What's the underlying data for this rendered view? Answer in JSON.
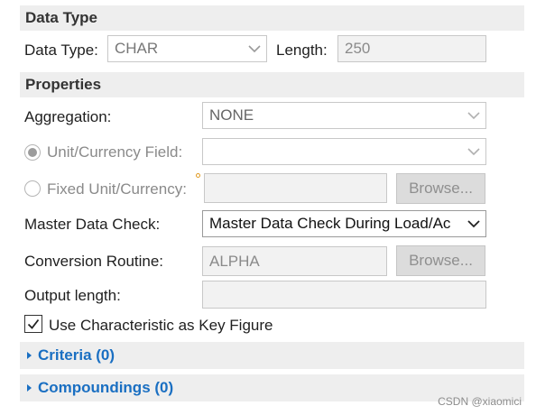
{
  "data_type_section": {
    "title": "Data Type",
    "data_type_label": "Data Type:",
    "data_type_value": "CHAR",
    "length_label": "Length:",
    "length_value": "250"
  },
  "properties_section": {
    "title": "Properties",
    "aggregation_label": "Aggregation:",
    "aggregation_value": "NONE",
    "unit_currency_field_label": "Unit/Currency Field:",
    "unit_currency_field_value": "",
    "fixed_unit_currency_label": "Fixed Unit/Currency:",
    "fixed_unit_currency_value": "",
    "browse_label": "Browse...",
    "master_data_check_label": "Master Data Check:",
    "master_data_check_value": "Master Data Check During Load/Ac",
    "conversion_routine_label": "Conversion Routine:",
    "conversion_routine_value": "ALPHA",
    "output_length_label": "Output length:",
    "output_length_value": "",
    "use_characteristic_label": "Use Characteristic as Key Figure",
    "use_characteristic_checked": true
  },
  "collapsible_sections": [
    {
      "label": "Criteria (0)"
    },
    {
      "label": "Compoundings (0)"
    }
  ],
  "watermark": "CSDN @xiaomici"
}
